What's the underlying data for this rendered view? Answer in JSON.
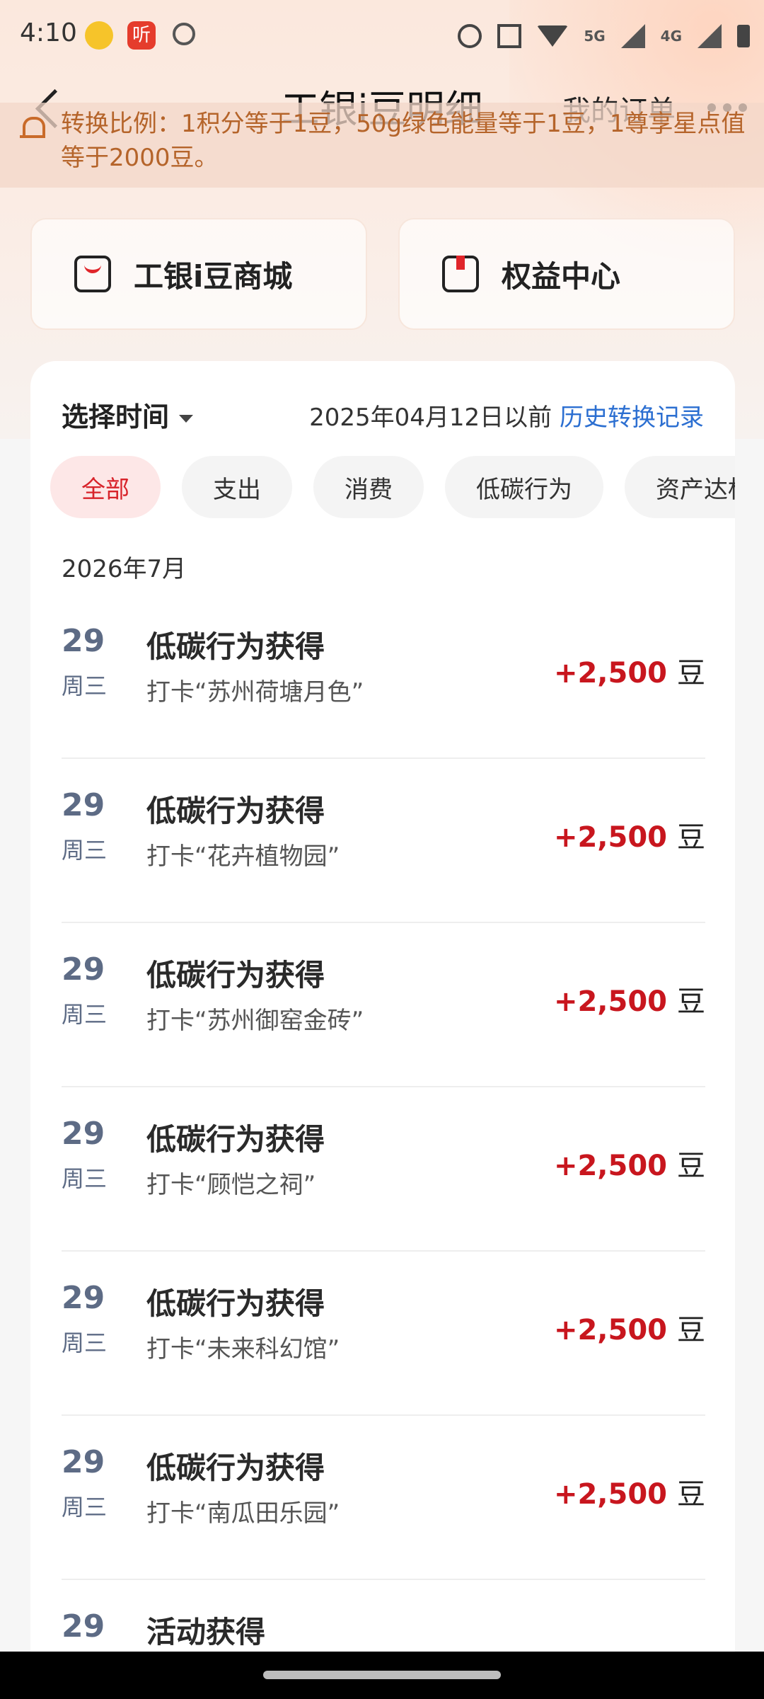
{
  "status_bar": {
    "time": "4:10",
    "app_badge": "听",
    "net_5g": "5G",
    "net_4g": "4G"
  },
  "header": {
    "title": "工银i豆明细",
    "right_link": "我的订单"
  },
  "notice": {
    "text": "转换比例：1积分等于1豆，50g绿色能量等于1豆，1尊享星点值等于2000豆。"
  },
  "entries": [
    {
      "label": "工银i豆商城",
      "icon": "shopping-bag-icon"
    },
    {
      "label": "权益中心",
      "icon": "book-icon"
    }
  ],
  "filters": {
    "select_time": "选择时间",
    "date_note": "2025年04月12日以前",
    "history_link": "历史转换记录"
  },
  "tabs": [
    {
      "label": "全部",
      "active": true
    },
    {
      "label": "支出",
      "active": false
    },
    {
      "label": "消费",
      "active": false
    },
    {
      "label": "低碳行为",
      "active": false
    },
    {
      "label": "资产达标",
      "active": false
    }
  ],
  "month_header": "2026年7月",
  "records": [
    {
      "day": "29",
      "weekday": "周三",
      "title": "低碳行为获得",
      "subtitle": "打卡“苏州荷塘月色”",
      "amount": "+2,500",
      "unit": "豆"
    },
    {
      "day": "29",
      "weekday": "周三",
      "title": "低碳行为获得",
      "subtitle": "打卡“花卉植物园”",
      "amount": "+2,500",
      "unit": "豆"
    },
    {
      "day": "29",
      "weekday": "周三",
      "title": "低碳行为获得",
      "subtitle": "打卡“苏州御窑金砖”",
      "amount": "+2,500",
      "unit": "豆"
    },
    {
      "day": "29",
      "weekday": "周三",
      "title": "低碳行为获得",
      "subtitle": "打卡“顾恺之祠”",
      "amount": "+2,500",
      "unit": "豆"
    },
    {
      "day": "29",
      "weekday": "周三",
      "title": "低碳行为获得",
      "subtitle": "打卡“未来科幻馆”",
      "amount": "+2,500",
      "unit": "豆"
    },
    {
      "day": "29",
      "weekday": "周三",
      "title": "低碳行为获得",
      "subtitle": "打卡“南瓜田乐园”",
      "amount": "+2,500",
      "unit": "豆"
    },
    {
      "day": "29",
      "weekday": "",
      "title": "活动获得",
      "subtitle": "",
      "amount": "",
      "unit": ""
    }
  ],
  "colors": {
    "accent_red": "#c8161e",
    "link_blue": "#2c6fd1",
    "notice_text": "#b5642a"
  }
}
